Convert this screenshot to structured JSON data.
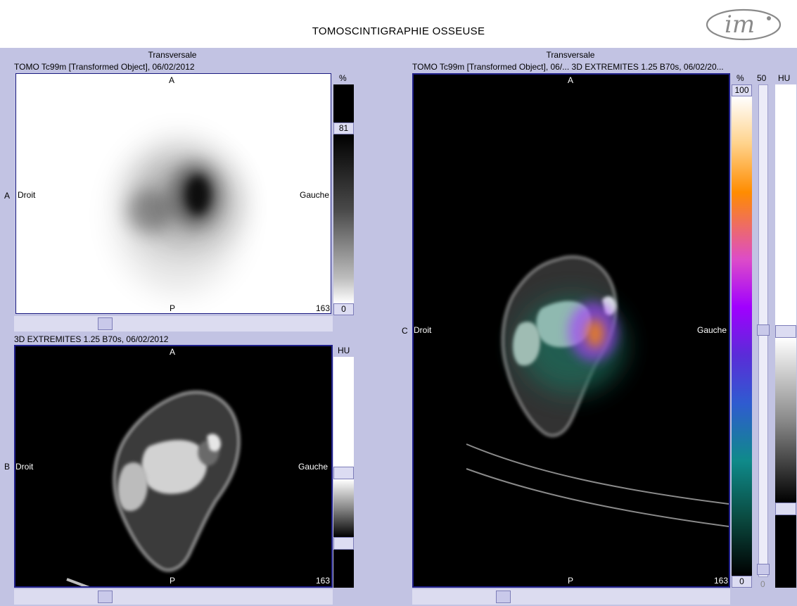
{
  "header": {
    "title": "TOMOSCINTIGRAPHIE OSSEUSE",
    "logo_icon": "im-logo"
  },
  "panel_a": {
    "view_title": "Transversale",
    "series_label": "TOMO Tc99m [Transformed Object], 06/02/2012",
    "row_label": "A",
    "orient_top": "A",
    "orient_bottom": "P",
    "orient_left": "Droit",
    "orient_right": "Gauche",
    "slice": "163",
    "colorbar": {
      "unit": "%",
      "top_value": "81",
      "bottom_value": "0"
    }
  },
  "panel_b": {
    "series_label": "3D EXTREMITES  1.25  B70s, 06/02/2012",
    "row_label": "B",
    "orient_top": "A",
    "orient_bottom": "P",
    "orient_left": "Droit",
    "orient_right": "Gauche",
    "slice": "163",
    "colorbar": {
      "unit": "HU"
    }
  },
  "panel_c": {
    "view_title": "Transversale",
    "series_label": "TOMO Tc99m [Transformed Object], 06/...  3D EXTREMITES  1.25  B70s, 06/02/20...",
    "row_label": "C",
    "orient_top": "A",
    "orient_bottom": "P",
    "orient_left": "Droit",
    "orient_right": "Gauche",
    "slice": "163",
    "colorbar": {
      "unit": "%",
      "top_value": "100",
      "bottom_value": "0"
    },
    "blend": {
      "label": "50",
      "bottom_value": "0"
    },
    "hu_bar": {
      "unit": "HU"
    }
  },
  "colors": {
    "background": "#c2c3e3",
    "frame": "#20208a",
    "accent_hot": "#ff8a00"
  }
}
